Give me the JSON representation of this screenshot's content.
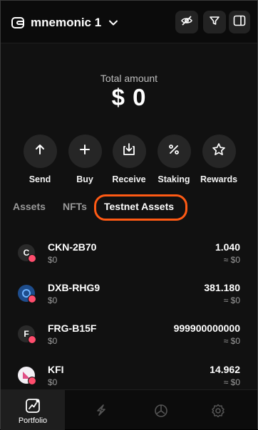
{
  "header": {
    "wallet_name": "mnemonic 1"
  },
  "balance": {
    "label": "Total amount",
    "amount": "$ 0"
  },
  "actions": [
    {
      "label": "Send",
      "icon": "arrow-up-icon"
    },
    {
      "label": "Buy",
      "icon": "plus-icon"
    },
    {
      "label": "Receive",
      "icon": "receive-icon"
    },
    {
      "label": "Staking",
      "icon": "percent-icon"
    },
    {
      "label": "Rewards",
      "icon": "star-icon"
    }
  ],
  "tabs": [
    {
      "label": "Assets",
      "active": false
    },
    {
      "label": "NFTs",
      "active": false
    },
    {
      "label": "Testnet Assets",
      "active": true
    }
  ],
  "highlight_color": "#ff5a14",
  "tokens": [
    {
      "initial": "C",
      "name": "CKN-2B70",
      "value": "$0",
      "amount": "1.040",
      "fiat": "≈ $0"
    },
    {
      "initial": "",
      "name": "DXB-RHG9",
      "value": "$0",
      "amount": "381.180",
      "fiat": "≈ $0"
    },
    {
      "initial": "F",
      "name": "FRG-B15F",
      "value": "$0",
      "amount": "999900000000",
      "fiat": "≈ $0"
    },
    {
      "initial": "",
      "name": "KFI",
      "value": "$0",
      "amount": "14.962",
      "fiat": "≈ $0"
    }
  ],
  "bottom_nav": [
    {
      "label": "Portfolio",
      "icon": "portfolio-chart-icon",
      "active": true
    },
    {
      "label": "",
      "icon": "swap-icon",
      "active": false
    },
    {
      "label": "",
      "icon": "history-clock-icon",
      "active": false
    },
    {
      "label": "",
      "icon": "settings-gear-icon",
      "active": false
    }
  ]
}
